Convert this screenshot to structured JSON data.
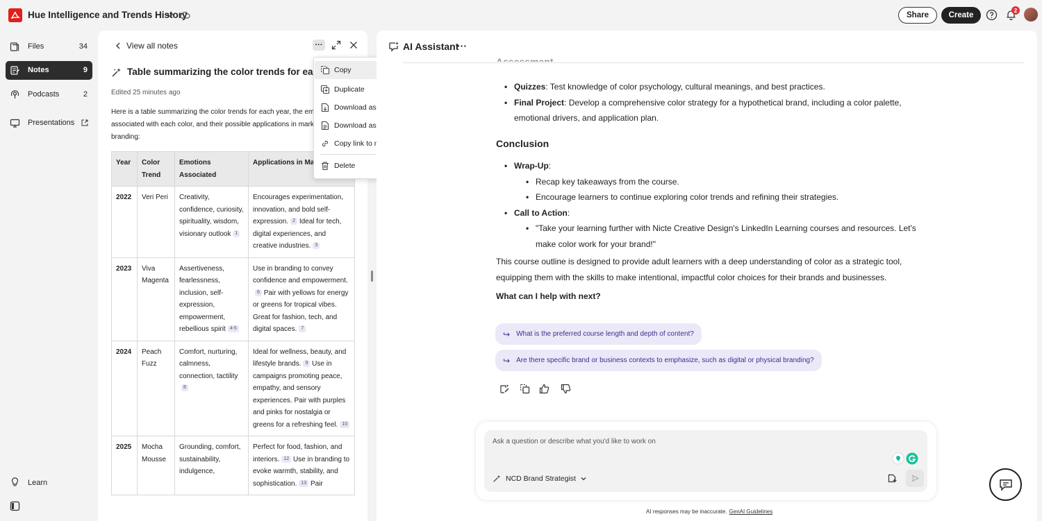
{
  "app": {
    "title": "Hue Intelligence and Trends History",
    "share_label": "Share",
    "create_label": "Create",
    "notification_count": "2",
    "brand_color": "#e0201c"
  },
  "sidebar": {
    "items": [
      {
        "label": "Files",
        "count": "34",
        "icon": "files-icon"
      },
      {
        "label": "Notes",
        "count": "9",
        "icon": "notes-icon"
      },
      {
        "label": "Podcasts",
        "count": "2",
        "icon": "podcasts-icon"
      },
      {
        "label": "Presentations",
        "count": "",
        "icon": "presentations-icon"
      }
    ],
    "learn_label": "Learn"
  },
  "note": {
    "back_label": "View all notes",
    "title": "Table summarizing the color trends for each y",
    "edited": "Edited 25 minutes ago",
    "intro": "Here is a table summarizing the color trends for each year, the emotions associated with each color, and their possible applications in marketing and branding:",
    "table": {
      "headers": [
        "Year",
        "Color Trend",
        "Emotions Associated",
        "Applications in Marketing and Branding"
      ],
      "rows": [
        {
          "year": "2022",
          "color": "Veri Peri",
          "emotions": "Creativity, confidence, curiosity, spirituality, wisdom, visionary outlook",
          "emotions_cite": "1",
          "applications": [
            {
              "text": "Encourages experimentation, innovation, and bold self-expression.",
              "cite": "2"
            },
            {
              "text": "Ideal for tech, digital experiences, and creative industries.",
              "cite": "3"
            }
          ]
        },
        {
          "year": "2023",
          "color": "Viva Magenta",
          "emotions": "Assertiveness, fearlessness, inclusion, self-expression, empowerment, rebellious spirit",
          "emotions_cite": "4-5",
          "applications": [
            {
              "text": "Use in branding to convey confidence and empowerment.",
              "cite": "6"
            },
            {
              "text": "Pair with yellows for energy or greens for tropical vibes. Great for fashion, tech, and digital spaces.",
              "cite": "7"
            }
          ]
        },
        {
          "year": "2024",
          "color": "Peach Fuzz",
          "emotions": "Comfort, nurturing, calmness, connection, tactility",
          "emotions_cite": "8",
          "applications": [
            {
              "text": "Ideal for wellness, beauty, and lifestyle brands.",
              "cite": "9"
            },
            {
              "text": "Use in campaigns promoting peace, empathy, and sensory experiences. Pair with purples and pinks for nostalgia or greens for a refreshing feel.",
              "cite": "10"
            }
          ]
        },
        {
          "year": "2025",
          "color": "Mocha Mousse",
          "emotions": "Grounding, comfort, sustainability, indulgence,",
          "emotions_cite": "",
          "applications": [
            {
              "text": "Perfect for food, fashion, and interiors.",
              "cite": "12"
            },
            {
              "text": "Use in branding to evoke warmth, stability, and sophistication.",
              "cite": "13"
            },
            {
              "text": "Pair",
              "cite": ""
            }
          ]
        }
      ]
    }
  },
  "context_menu": {
    "items": [
      "Copy",
      "Duplicate",
      "Download as PDF",
      "Download as DOCX",
      "Copy link to note",
      "Delete"
    ]
  },
  "assistant": {
    "title": "AI Assistant",
    "clipped_heading": "Assessment",
    "assessment": [
      {
        "label": "Quizzes",
        "text": ": Test knowledge of color psychology, cultural meanings, and best practices."
      },
      {
        "label": "Final Project",
        "text": ": Develop a comprehensive color strategy for a hypothetical brand, including a color palette, emotional drivers, and application plan."
      }
    ],
    "conclusion_heading": "Conclusion",
    "wrapup_label": "Wrap-Up",
    "wrapup_items": [
      "Recap key takeaways from the course.",
      "Encourage learners to continue exploring color trends and refining their strategies."
    ],
    "cta_label": "Call to Action",
    "cta_items": [
      "\"Take your learning further with Nicte Creative Design's LinkedIn Learning courses and resources. Let's make color work for your brand!\""
    ],
    "summary": "This course outline is designed to provide adult learners with a deep understanding of color as a strategic tool, equipping them with the skills to make intentional, impactful color choices for their brands and businesses.",
    "next_prompt": "What can I help with next?",
    "suggestions": [
      "What is the preferred course length and depth of content?",
      "Are there specific brand or business contexts to emphasize, such as digital or physical branding?"
    ],
    "composer_placeholder": "Ask a question or describe what you'd like to work on",
    "agent_name": "NCD Brand Strategist",
    "disclaimer": "AI responses may be inaccurate.",
    "guidelines_link": "GenAI Guidelines",
    "chip_color": "#ebe9f8"
  }
}
